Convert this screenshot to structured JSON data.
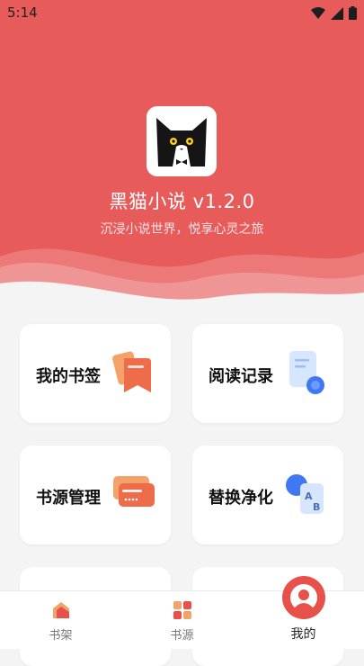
{
  "status_bar": {
    "time": "5:14"
  },
  "app": {
    "name": "黑猫小说 v1.2.0",
    "slogan": "沉浸小说世界，悦享心灵之旅"
  },
  "colors": {
    "accent": "#e85b5b"
  },
  "menu": [
    {
      "label": "我的书签",
      "icon": "bookmark-icon"
    },
    {
      "label": "阅读记录",
      "icon": "reading-history-icon"
    },
    {
      "label": "书源管理",
      "icon": "source-management-icon"
    },
    {
      "label": "替换净化",
      "icon": "replace-purify-icon"
    }
  ],
  "bottom_nav": [
    {
      "label": "书架",
      "icon": "bookshelf-icon"
    },
    {
      "label": "书源",
      "icon": "book-source-icon"
    },
    {
      "label": "我的",
      "icon": "profile-icon",
      "active": true
    }
  ]
}
